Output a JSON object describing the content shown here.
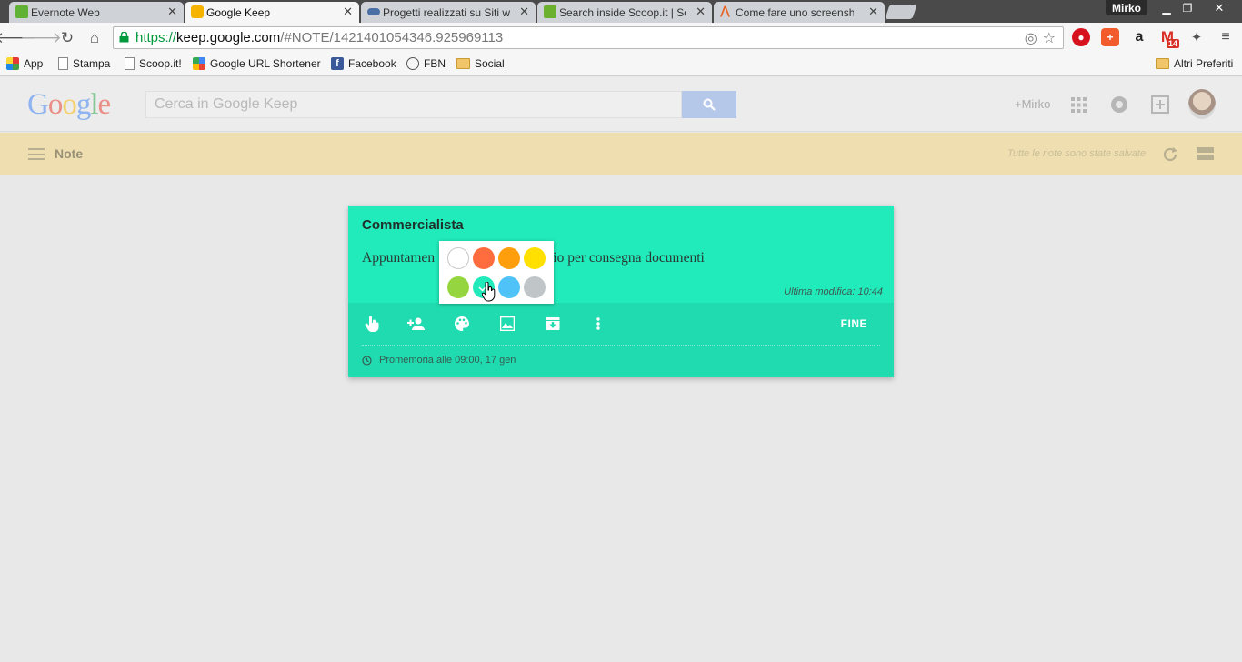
{
  "browser": {
    "tabs": [
      {
        "title": "Evernote Web",
        "active": false,
        "favicon_color": "#5fb236"
      },
      {
        "title": "Google Keep",
        "active": true,
        "favicon_color": "#f6b400"
      },
      {
        "title": "Progetti realizzati su Siti w",
        "active": false,
        "favicon_color": "#4a6fa5"
      },
      {
        "title": "Search inside Scoop.it | Sc",
        "active": false,
        "favicon_color": "#6bb12d"
      },
      {
        "title": "Come fare uno screenshot",
        "active": false,
        "favicon_color": "#e6652a"
      }
    ],
    "user": "Mirko",
    "url": {
      "scheme": "https://",
      "host": "keep.google.com",
      "path": "/#NOTE/1421401054346.925969113"
    },
    "bookmarks": [
      "App",
      "Stampa",
      "Scoop.it!",
      "Google URL Shortener",
      "Facebook",
      "FBN",
      "Social"
    ],
    "other_bookmarks": "Altri Preferiti",
    "extension_badge": "14"
  },
  "keep": {
    "logo": "Google",
    "search_placeholder": "Cerca in Google Keep",
    "account_link": "+Mirko",
    "section_title": "Note",
    "saved_status": "Tutte le note sono state salvate"
  },
  "note": {
    "title": "Commercialista",
    "body_start": "Appuntamen",
    "body_end": "icio per consegna documenti",
    "modified": "Ultima modifica: 10:44",
    "done_label": "FINE",
    "reminder": "Promemoria alle 09:00, 17 gen",
    "color": "#21eabb",
    "toolbar_color": "#20dbaf"
  },
  "palette": {
    "colors": [
      "#ffffff",
      "#ff6d3f",
      "#ff9e0d",
      "#ffe000",
      "#95d640",
      "#21eabb",
      "#4fc3f7",
      "#c0c6c8"
    ],
    "selected_index": 5
  }
}
